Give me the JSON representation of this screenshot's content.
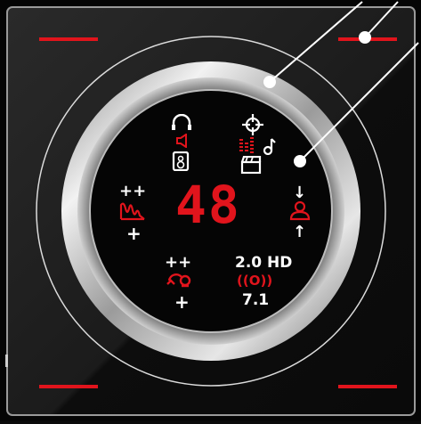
{
  "display": {
    "volume_value": "48",
    "volume_label": "++",
    "volume_minus": "+",
    "mic_plus": "++",
    "mic_minus": "+",
    "mode_stereo": "2.0 HD",
    "mode_surround_icon": "((O))",
    "mode_surround": "7.1",
    "mic_monitor_up": "↓",
    "mic_monitor_down": "↑"
  },
  "icons": {
    "headset": "headset-icon",
    "speaker_small": "speaker-small-icon",
    "speaker": "speaker-icon",
    "game_crosshair": "crosshair-icon",
    "music": "music-note-icon",
    "movie": "clapperboard-icon",
    "equalizer": "equalizer-icon",
    "bass": "bass-wave-icon",
    "mic_monitor": "user-mic-icon",
    "mic": "mic-icon"
  },
  "colors": {
    "accent_red": "#e1141c",
    "white": "#ffffff",
    "background": "#0b0b0b"
  }
}
